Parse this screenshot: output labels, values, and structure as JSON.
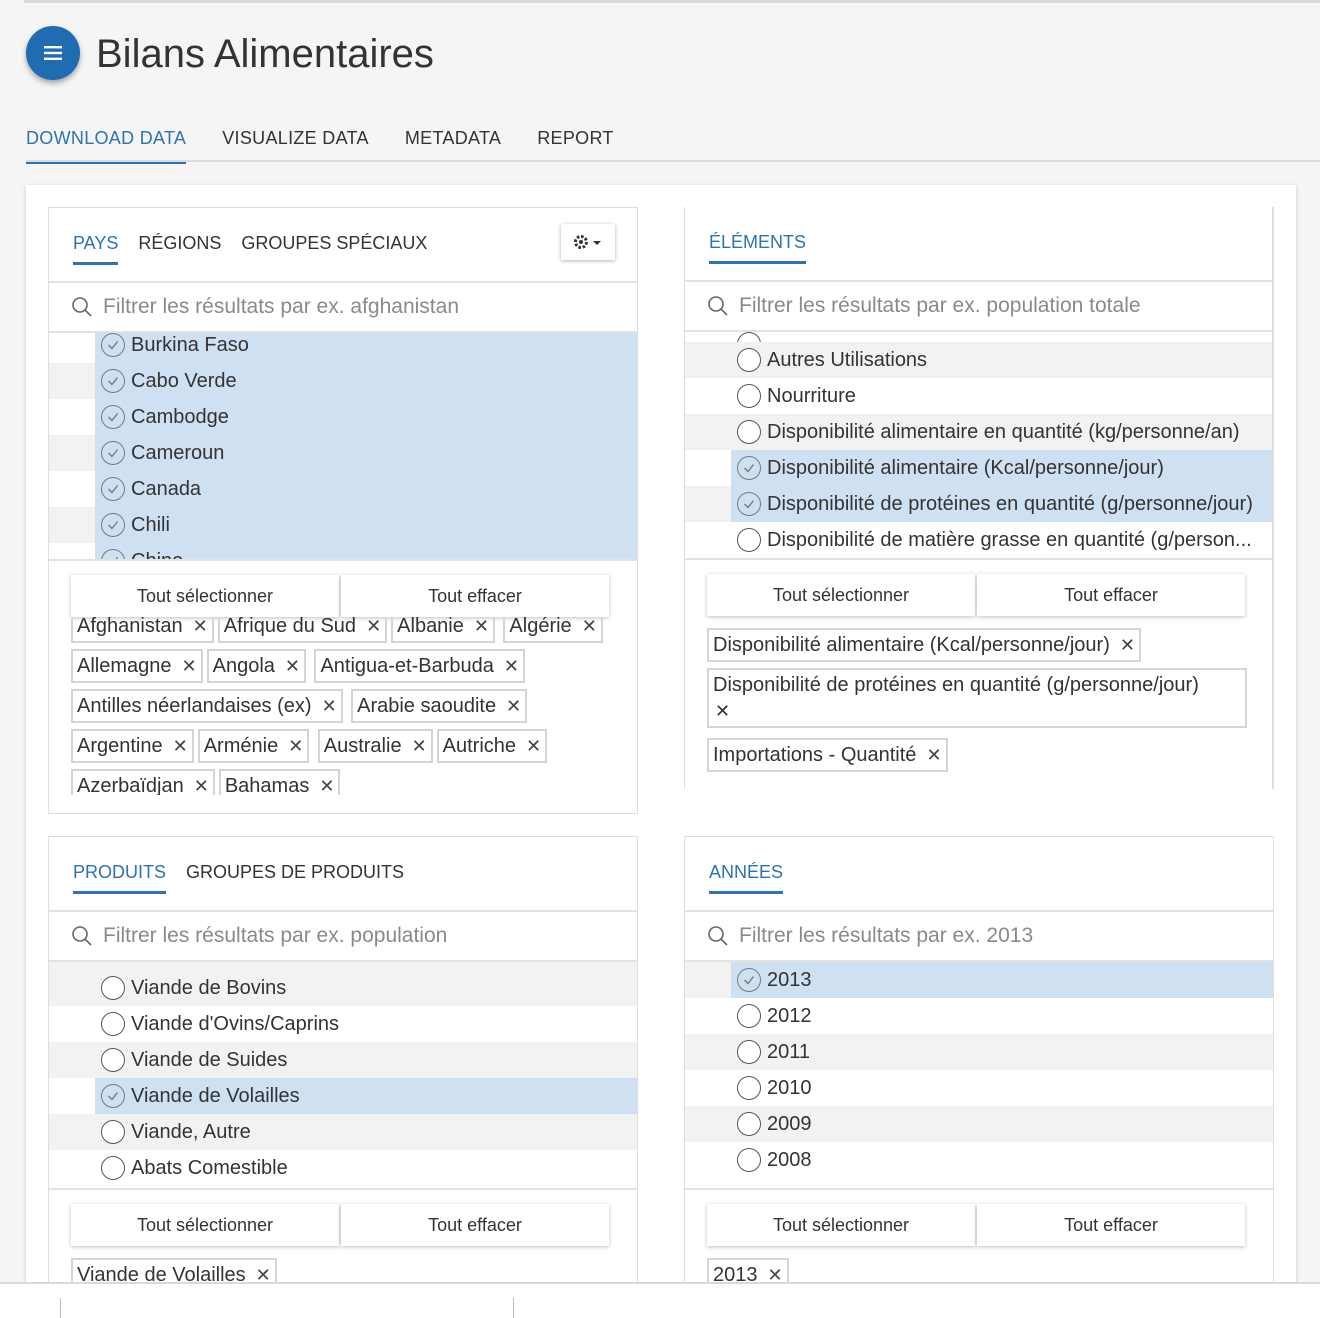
{
  "app": {
    "title": "Bilans Alimentaires"
  },
  "main_tabs": [
    "DOWNLOAD DATA",
    "VISUALIZE DATA",
    "METADATA",
    "REPORT"
  ],
  "panels": {
    "pays": {
      "tabs": [
        "PAYS",
        "RÉGIONS",
        "GROUPES SPÉCIAUX"
      ],
      "search_placeholder": "Filtrer les résultats par ex. afghanistan",
      "items": [
        "Burkina Faso",
        "Cabo Verde",
        "Cambodge",
        "Cameroun",
        "Canada",
        "Chili",
        "Chine"
      ],
      "select_all": "Tout sélectionner",
      "clear_all": "Tout effacer",
      "chips": [
        "Afghanistan",
        "Afrique du Sud",
        "Albanie",
        "Algérie",
        "Allemagne",
        "Angola",
        "Antigua-et-Barbuda",
        "Antilles néerlandaises (ex)",
        "Arabie saoudite",
        "Argentine",
        "Arménie",
        "Australie",
        "Autriche",
        "Azerbaïdjan",
        "Bahamas"
      ]
    },
    "elements": {
      "tabs": [
        "ÉLÉMENTS"
      ],
      "search_placeholder": "Filtrer les résultats par ex. population totale",
      "items": [
        "Autres Utilisations",
        "Nourriture",
        "Disponibilité alimentaire en quantité (kg/personne/an)",
        "Disponibilité alimentaire (Kcal/personne/jour)",
        "Disponibilité de protéines en quantité (g/personne/jour)",
        "Disponibilité de matière grasse en quantité (g/person..."
      ],
      "select_all": "Tout sélectionner",
      "clear_all": "Tout effacer",
      "chips": [
        "Disponibilité alimentaire (Kcal/personne/jour)",
        "Disponibilité de protéines en quantité (g/personne/jour)",
        "Importations - Quantité"
      ]
    },
    "produits": {
      "tabs": [
        "PRODUITS",
        "GROUPES DE PRODUITS"
      ],
      "search_placeholder": "Filtrer les résultats par ex. population",
      "items": [
        "Viande de Bovins",
        "Viande d'Ovins/Caprins",
        "Viande de Suides",
        "Viande de Volailles",
        "Viande, Autre",
        "Abats Comestible"
      ],
      "select_all": "Tout sélectionner",
      "clear_all": "Tout effacer",
      "chips": [
        "Viande de Volailles"
      ]
    },
    "annees": {
      "tabs": [
        "ANNÉES"
      ],
      "search_placeholder": "Filtrer les résultats par ex. 2013",
      "items": [
        "2013",
        "2012",
        "2011",
        "2010",
        "2009",
        "2008"
      ],
      "select_all": "Tout sélectionner",
      "clear_all": "Tout effacer",
      "chips": [
        "2013"
      ]
    }
  },
  "icons": {
    "menu": "hamburger-icon",
    "gear": "gear-icon",
    "search": "search-icon",
    "check": "check-circle-icon",
    "remove": "close-icon"
  },
  "colors": {
    "accent": "#2b73b3",
    "selected_row": "#cfe0f2",
    "menu_button": "#1f6cb1"
  }
}
